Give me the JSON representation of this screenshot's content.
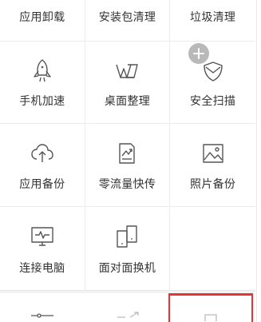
{
  "tools": {
    "row0": [
      {
        "label": "应用卸载"
      },
      {
        "label": "安装包清理"
      },
      {
        "label": "垃圾清理"
      }
    ],
    "row1": [
      {
        "label": "手机加速",
        "icon": "rocket-icon"
      },
      {
        "label": "桌面整理",
        "icon": "desktop-organize-icon"
      },
      {
        "label": "安全扫描",
        "icon": "shield-icon"
      }
    ],
    "row2": [
      {
        "label": "应用备份",
        "icon": "cloud-upload-icon"
      },
      {
        "label": "零流量快传",
        "icon": "zero-traffic-transfer-icon"
      },
      {
        "label": "照片备份",
        "icon": "photo-icon"
      }
    ],
    "row3": [
      {
        "label": "连接电脑",
        "icon": "monitor-icon"
      },
      {
        "label": "面对面换机",
        "icon": "phone-swap-icon"
      }
    ]
  },
  "add_badge": {
    "icon": "plus-icon"
  },
  "colors": {
    "accent": "#e93232",
    "text": "#333333",
    "icon_stroke": "#555555",
    "divider": "#ececec",
    "badge": "#b9b9b9"
  }
}
